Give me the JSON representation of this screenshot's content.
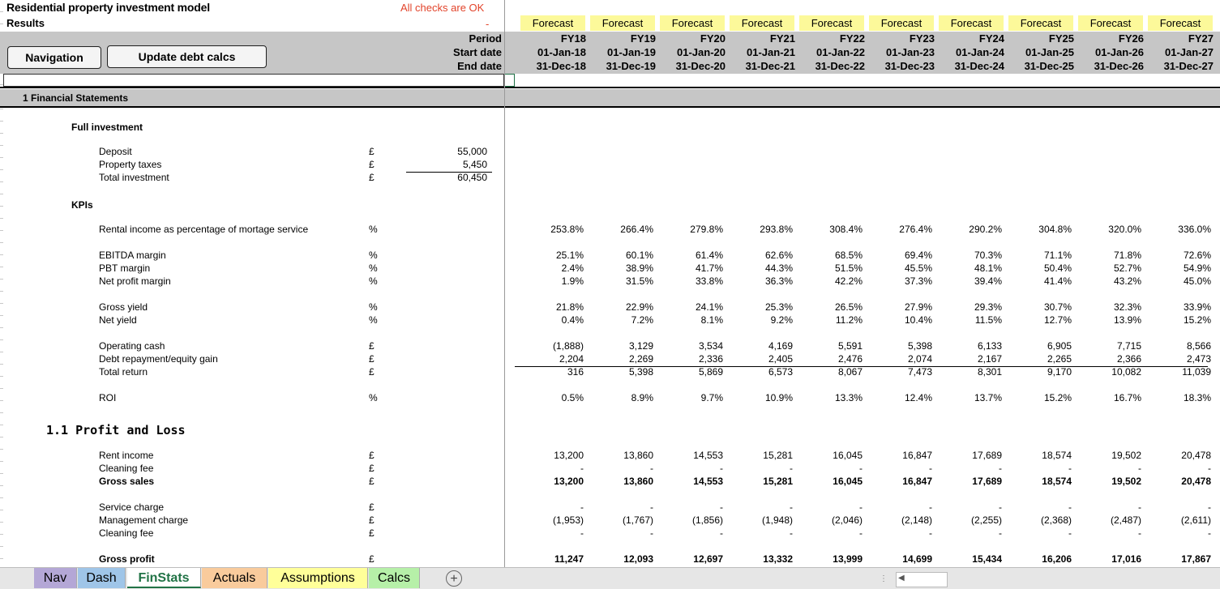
{
  "header": {
    "title": "Residential property investment model",
    "subtitle": "Results",
    "checks_status": "All checks are OK",
    "checks_mark": "-",
    "period_label": "Period",
    "start_label": "Start date",
    "end_label": "End date"
  },
  "buttons": {
    "navigation": "Navigation",
    "update_debt": "Update debt calcs"
  },
  "columns": [
    {
      "type": "Forecast",
      "period": "FY18",
      "start": "01-Jan-18",
      "end": "31-Dec-18"
    },
    {
      "type": "Forecast",
      "period": "FY19",
      "start": "01-Jan-19",
      "end": "31-Dec-19"
    },
    {
      "type": "Forecast",
      "period": "FY20",
      "start": "01-Jan-20",
      "end": "31-Dec-20"
    },
    {
      "type": "Forecast",
      "period": "FY21",
      "start": "01-Jan-21",
      "end": "31-Dec-21"
    },
    {
      "type": "Forecast",
      "period": "FY22",
      "start": "01-Jan-22",
      "end": "31-Dec-22"
    },
    {
      "type": "Forecast",
      "period": "FY23",
      "start": "01-Jan-23",
      "end": "31-Dec-23"
    },
    {
      "type": "Forecast",
      "period": "FY24",
      "start": "01-Jan-24",
      "end": "31-Dec-24"
    },
    {
      "type": "Forecast",
      "period": "FY25",
      "start": "01-Jan-25",
      "end": "31-Dec-25"
    },
    {
      "type": "Forecast",
      "period": "FY26",
      "start": "01-Jan-26",
      "end": "31-Dec-26"
    },
    {
      "type": "Forecast",
      "period": "FY27",
      "start": "01-Jan-27",
      "end": "31-Dec-27"
    }
  ],
  "section1": "1 Financial Statements",
  "full_investment": {
    "heading": "Full investment",
    "rows": [
      {
        "label": "Deposit",
        "unit": "£",
        "value": "55,000"
      },
      {
        "label": "Property taxes",
        "unit": "£",
        "value": "5,450"
      },
      {
        "label": "Total investment",
        "unit": "£",
        "value": "60,450"
      }
    ]
  },
  "kpis": {
    "heading": "KPIs",
    "rows": [
      {
        "label": "Rental income as percentage of mortage service",
        "unit": "%",
        "values": [
          "253.8%",
          "266.4%",
          "279.8%",
          "293.8%",
          "308.4%",
          "276.4%",
          "290.2%",
          "304.8%",
          "320.0%",
          "336.0%"
        ]
      },
      {
        "label": "EBITDA margin",
        "unit": "%",
        "values": [
          "25.1%",
          "60.1%",
          "61.4%",
          "62.6%",
          "68.5%",
          "69.4%",
          "70.3%",
          "71.1%",
          "71.8%",
          "72.6%"
        ]
      },
      {
        "label": "PBT margin",
        "unit": "%",
        "values": [
          "2.4%",
          "38.9%",
          "41.7%",
          "44.3%",
          "51.5%",
          "45.5%",
          "48.1%",
          "50.4%",
          "52.7%",
          "54.9%"
        ]
      },
      {
        "label": "Net profit margin",
        "unit": "%",
        "values": [
          "1.9%",
          "31.5%",
          "33.8%",
          "36.3%",
          "42.2%",
          "37.3%",
          "39.4%",
          "41.4%",
          "43.2%",
          "45.0%"
        ]
      },
      {
        "label": "Gross yield",
        "unit": "%",
        "values": [
          "21.8%",
          "22.9%",
          "24.1%",
          "25.3%",
          "26.5%",
          "27.9%",
          "29.3%",
          "30.7%",
          "32.3%",
          "33.9%"
        ]
      },
      {
        "label": "Net yield",
        "unit": "%",
        "values": [
          "0.4%",
          "7.2%",
          "8.1%",
          "9.2%",
          "11.2%",
          "10.4%",
          "11.5%",
          "12.7%",
          "13.9%",
          "15.2%"
        ]
      },
      {
        "label": "Operating cash",
        "unit": "£",
        "values": [
          "(1,888)",
          "3,129",
          "3,534",
          "4,169",
          "5,591",
          "5,398",
          "6,133",
          "6,905",
          "7,715",
          "8,566"
        ]
      },
      {
        "label": "Debt repayment/equity gain",
        "unit": "£",
        "values": [
          "2,204",
          "2,269",
          "2,336",
          "2,405",
          "2,476",
          "2,074",
          "2,167",
          "2,265",
          "2,366",
          "2,473"
        ]
      },
      {
        "label": "Total return",
        "unit": "£",
        "values": [
          "316",
          "5,398",
          "5,869",
          "6,573",
          "8,067",
          "7,473",
          "8,301",
          "9,170",
          "10,082",
          "11,039"
        ]
      },
      {
        "label": "ROI",
        "unit": "%",
        "values": [
          "0.5%",
          "8.9%",
          "9.7%",
          "10.9%",
          "13.3%",
          "12.4%",
          "13.7%",
          "15.2%",
          "16.7%",
          "18.3%"
        ]
      }
    ]
  },
  "pnl": {
    "heading": "1.1 Profit and Loss",
    "rows": [
      {
        "label": "Rent income",
        "unit": "£",
        "values": [
          "13,200",
          "13,860",
          "14,553",
          "15,281",
          "16,045",
          "16,847",
          "17,689",
          "18,574",
          "19,502",
          "20,478"
        ]
      },
      {
        "label": "Cleaning fee",
        "unit": "£",
        "values": [
          "-",
          "-",
          "-",
          "-",
          "-",
          "-",
          "-",
          "-",
          "-",
          "-"
        ]
      },
      {
        "label": "Gross sales",
        "unit": "£",
        "values": [
          "13,200",
          "13,860",
          "14,553",
          "15,281",
          "16,045",
          "16,847",
          "17,689",
          "18,574",
          "19,502",
          "20,478"
        ]
      },
      {
        "label": "Service charge",
        "unit": "£",
        "values": [
          "-",
          "-",
          "-",
          "-",
          "-",
          "-",
          "-",
          "-",
          "-",
          "-"
        ]
      },
      {
        "label": "Management charge",
        "unit": "£",
        "values": [
          "(1,953)",
          "(1,767)",
          "(1,856)",
          "(1,948)",
          "(2,046)",
          "(2,148)",
          "(2,255)",
          "(2,368)",
          "(2,487)",
          "(2,611)"
        ]
      },
      {
        "label": "Cleaning fee",
        "unit": "£",
        "values": [
          "-",
          "-",
          "-",
          "-",
          "-",
          "-",
          "-",
          "-",
          "-",
          "-"
        ]
      },
      {
        "label": "Gross profit",
        "unit": "£",
        "values": [
          "11,247",
          "12,093",
          "12,697",
          "13,332",
          "13,999",
          "14,699",
          "15,434",
          "16,206",
          "17,016",
          "17,867"
        ]
      }
    ]
  },
  "tabs": [
    {
      "label": "Nav",
      "color": "#b4a7d6"
    },
    {
      "label": "Dash",
      "color": "#9fc5e8"
    },
    {
      "label": "FinStats",
      "color": "#ffffff"
    },
    {
      "label": "Actuals",
      "color": "#f9cb9c"
    },
    {
      "label": "Assumptions",
      "color": "#ffff99"
    },
    {
      "label": "Calcs",
      "color": "#b6f0a8"
    }
  ],
  "add_sheet": "+"
}
